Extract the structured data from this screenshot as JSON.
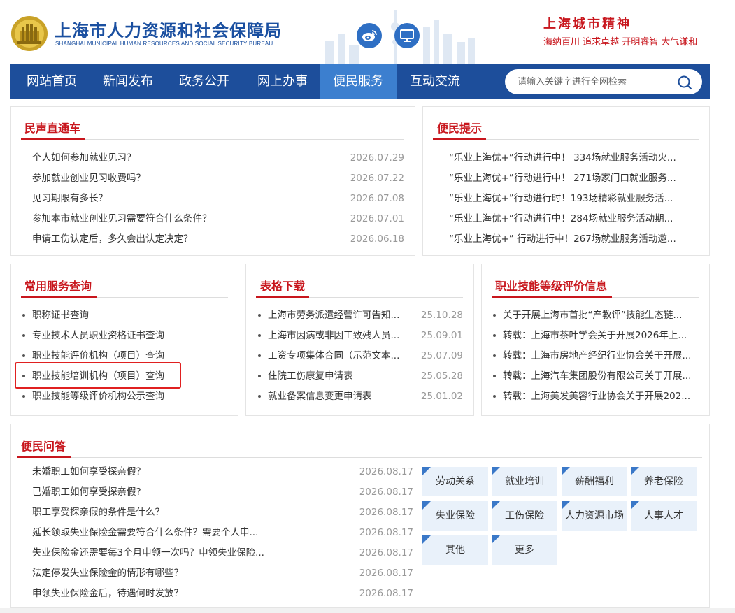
{
  "header": {
    "title": "上海市人力资源和社会保障局",
    "subtitle": "SHANGHAI MUNICIPAL HUMAN RESOURCES AND SOCIAL SECURITY BUREAU",
    "spirit_title": "上海城市精神",
    "spirit_values": "海纳百川  追求卓越  开明睿智  大气谦和"
  },
  "nav": {
    "items": [
      "网站首页",
      "新闻发布",
      "政务公开",
      "网上办事",
      "便民服务",
      "互动交流"
    ],
    "active": "便民服务",
    "search_placeholder": "请输入关键字进行全网检索"
  },
  "voice": {
    "title": "民声直通车",
    "items": [
      {
        "text": "个人如何参加就业见习？",
        "date": "2026.07.29"
      },
      {
        "text": "参加就业创业见习收费吗？",
        "date": "2026.07.22"
      },
      {
        "text": "见习期限有多长？",
        "date": "2026.07.08"
      },
      {
        "text": "参加本市就业创业见习需要符合什么条件？",
        "date": "2026.07.01"
      },
      {
        "text": "申请工伤认定后，多久会出认定决定？",
        "date": "2026.06.18"
      }
    ]
  },
  "tips": {
    "title": "便民提示",
    "items": [
      "“乐业上海优+”行动进行中！ 334场就业服务活动火...",
      "“乐业上海优+”行动进行中！ 271场家门口就业服务...",
      "“乐业上海优+”行动进行时！193场精彩就业服务活...",
      "“乐业上海优+”行动进行中！284场就业服务活动期...",
      "“乐业上海优+” 行动进行中！267场就业服务活动邀..."
    ]
  },
  "services": {
    "title": "常用服务查询",
    "items": [
      "职称证书查询",
      "专业技术人员职业资格证书查询",
      "职业技能评价机构（项目）查询",
      "职业技能培训机构（项目）查询",
      "职业技能等级评价机构公示查询"
    ]
  },
  "forms": {
    "title": "表格下载",
    "items": [
      {
        "text": "上海市劳务派遣经营许可告知...",
        "date": "25.10.28"
      },
      {
        "text": "上海市因病或非因工致残人员...",
        "date": "25.09.01"
      },
      {
        "text": "工资专项集体合同（示范文本...",
        "date": "25.07.09"
      },
      {
        "text": "住院工伤康复申请表",
        "date": "25.05.28"
      },
      {
        "text": "就业备案信息变更申请表",
        "date": "25.01.02"
      }
    ]
  },
  "skills": {
    "title": "职业技能等级评价信息",
    "items": [
      "关于开展上海市首批“产教评”技能生态链...",
      "转载：上海市茶叶学会关于开展2026年上...",
      "转载：上海市房地产经纪行业协会关于开展...",
      "转载：上海汽车集团股份有限公司关于开展...",
      "转载：上海美发美容行业协会关于开展202..."
    ]
  },
  "qa": {
    "title": "便民问答",
    "items": [
      {
        "text": "未婚职工如何享受探亲假？",
        "date": "2026.08.17"
      },
      {
        "text": "已婚职工如何享受探亲假?",
        "date": "2026.08.17"
      },
      {
        "text": "职工享受探亲假的条件是什么？",
        "date": "2026.08.17"
      },
      {
        "text": "延长领取失业保险金需要符合什么条件？需要个人申...",
        "date": "2026.08.17"
      },
      {
        "text": "失业保险金还需要每3个月申领一次吗？申领失业保险...",
        "date": "2026.08.17"
      },
      {
        "text": "法定停发失业保险金的情形有哪些？",
        "date": "2026.08.17"
      },
      {
        "text": "申领失业保险金后，待遇何时发放？",
        "date": "2026.08.17"
      }
    ],
    "tags": [
      "劳动关系",
      "就业培训",
      "薪酬福利",
      "养老保险",
      "失业保险",
      "工伤保险",
      "人力资源市场",
      "人事人才",
      "其他",
      "更多"
    ]
  },
  "colors": {
    "nav_bg": "#1d4e9b",
    "nav_active": "#3c7fcf",
    "accent_red": "#c8161d",
    "title_blue": "#1a4fa0",
    "tag_bg": "#e9f1fa"
  }
}
